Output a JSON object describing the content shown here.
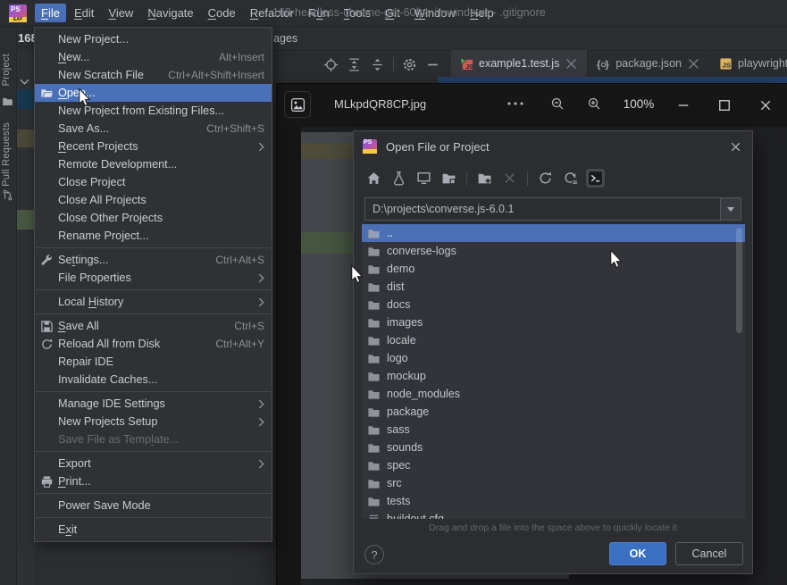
{
  "colors": {
    "accent_blue": "#4a70b8",
    "tree_selection": "#4b70b5",
    "ok_button": "#3a70c2",
    "editor_strip_blue": "#24406b"
  },
  "menubar": {
    "logo": "PS",
    "logo_badge": "EAP",
    "items": [
      {
        "label": "File",
        "u": 0,
        "active": true
      },
      {
        "label": "Edit",
        "u": 0
      },
      {
        "label": "View",
        "u": 0
      },
      {
        "label": "Navigate",
        "u": 0
      },
      {
        "label": "Code",
        "u": 0
      },
      {
        "label": "Refactor",
        "u": 0
      },
      {
        "label": "Run",
        "u": 1
      },
      {
        "label": "Tools",
        "u": 0
      },
      {
        "label": "Git",
        "u": 0
      },
      {
        "label": "Window",
        "u": 0
      },
      {
        "label": "Help",
        "u": 0
      }
    ],
    "window_title": "168-headless-chrome-get-60fps-in-windows - .gitignore"
  },
  "toolbar": {
    "project_name": "168-",
    "clipped_text": "ages"
  },
  "left_bar": {
    "items": [
      {
        "label": "Project",
        "icon": "folder"
      },
      {
        "label": "Pull Requests",
        "icon": "pull-request"
      }
    ]
  },
  "project_header": {
    "icons": [
      {
        "name": "locate"
      },
      {
        "name": "expand-all"
      },
      {
        "name": "collapse-all",
        "sep_after": true
      },
      {
        "name": "gear"
      },
      {
        "name": "hide"
      }
    ]
  },
  "editor_tabs": [
    {
      "label": "example1.test.js",
      "icon": "js-test",
      "active": true,
      "closable": true
    },
    {
      "label": "package.json",
      "icon": "json",
      "active": false,
      "closable": true
    },
    {
      "label": "playwright.config.js",
      "icon": "js",
      "active": false,
      "closable": false
    }
  ],
  "file_menu": {
    "items": [
      {
        "label": "New Project..."
      },
      {
        "label": "New...",
        "u": 0,
        "shortcut": "Alt+Insert"
      },
      {
        "label": "New Scratch File",
        "shortcut": "Ctrl+Alt+Shift+Insert"
      },
      {
        "label": "Open...",
        "u": 0,
        "icon": "open-folder",
        "selected": true
      },
      {
        "label": "New Project from Existing Files..."
      },
      {
        "label": "Save As...",
        "shortcut": "Ctrl+Shift+S"
      },
      {
        "label": "Recent Projects",
        "u": 0,
        "submenu": true
      },
      {
        "label": "Remote Development..."
      },
      {
        "label": "Close Project"
      },
      {
        "label": "Close All Projects"
      },
      {
        "label": "Close Other Projects"
      },
      {
        "label": "Rename Project...",
        "sep_after": true
      },
      {
        "label": "Settings...",
        "u": 2,
        "icon": "wrench",
        "shortcut": "Ctrl+Alt+S"
      },
      {
        "label": "File Properties",
        "submenu": true,
        "sep_after": true
      },
      {
        "label": "Local History",
        "u": 6,
        "submenu": true,
        "sep_after": true
      },
      {
        "label": "Save All",
        "u": 0,
        "icon": "floppy",
        "shortcut": "Ctrl+S"
      },
      {
        "label": "Reload All from Disk",
        "icon": "reload",
        "shortcut": "Ctrl+Alt+Y"
      },
      {
        "label": "Repair IDE"
      },
      {
        "label": "Invalidate Caches...",
        "sep_after": true
      },
      {
        "label": "Manage IDE Settings",
        "submenu": true
      },
      {
        "label": "New Projects Setup",
        "submenu": true
      },
      {
        "label": "Save File as Template...",
        "u": 17,
        "disabled": true,
        "sep_after": true
      },
      {
        "label": "Export",
        "submenu": true
      },
      {
        "label": "Print...",
        "u": 0,
        "icon": "printer",
        "sep_after": true
      },
      {
        "label": "Power Save Mode",
        "sep_after": true
      },
      {
        "label": "Exit",
        "u": 1
      }
    ]
  },
  "viewer": {
    "title": "MLkpdQR8CP.jpg",
    "zoom_level": "100%"
  },
  "dialog": {
    "title": "Open File or Project",
    "toolbar_icons": [
      {
        "name": "home"
      },
      {
        "name": "flask"
      },
      {
        "name": "desktop"
      },
      {
        "name": "project-folder",
        "sep_after": true
      },
      {
        "name": "new-folder"
      },
      {
        "name": "delete",
        "disabled": true,
        "sep_after": true
      },
      {
        "name": "refresh"
      },
      {
        "name": "sync"
      },
      {
        "name": "terminal",
        "pressed": true
      }
    ],
    "path": "D:\\projects\\converse.js-6.0.1",
    "tree": {
      "parent": "..",
      "folders": [
        "converse-logs",
        "demo",
        "dist",
        "docs",
        "images",
        "locale",
        "logo",
        "mockup",
        "node_modules",
        "package",
        "sass",
        "sounds",
        "spec",
        "src",
        "tests"
      ],
      "file": "buildout.cfg"
    },
    "hint": "Drag and drop a file into the space above to quickly locate it",
    "help": "?",
    "buttons": {
      "ok": "OK",
      "cancel": "Cancel"
    }
  }
}
